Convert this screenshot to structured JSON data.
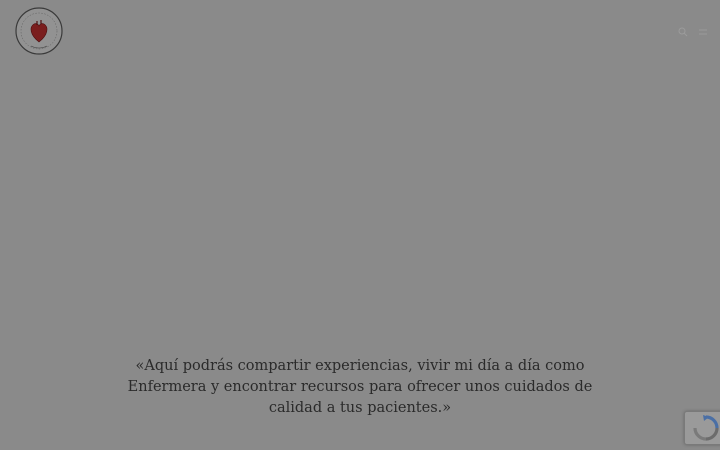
{
  "logo": {
    "icon": "heart-icon",
    "ring_color": "#3a3a3a",
    "heart_color": "#7a1e1e"
  },
  "header": {
    "icons": [
      "search-icon",
      "menu-icon"
    ]
  },
  "main": {
    "quote": "«Aquí podrás compartir experiencias, vivir mi día a día como Enfermera y encontrar recursos para ofrecer unos cuidados de calidad a tus pacientes.»"
  },
  "recaptcha": {
    "icon": "recaptcha-icon",
    "colors": {
      "blue": "#4a6fa5",
      "gray": "#6c6c6c"
    }
  },
  "colors": {
    "overlay": "#8a8a8a",
    "text": "#2a2a2a"
  }
}
